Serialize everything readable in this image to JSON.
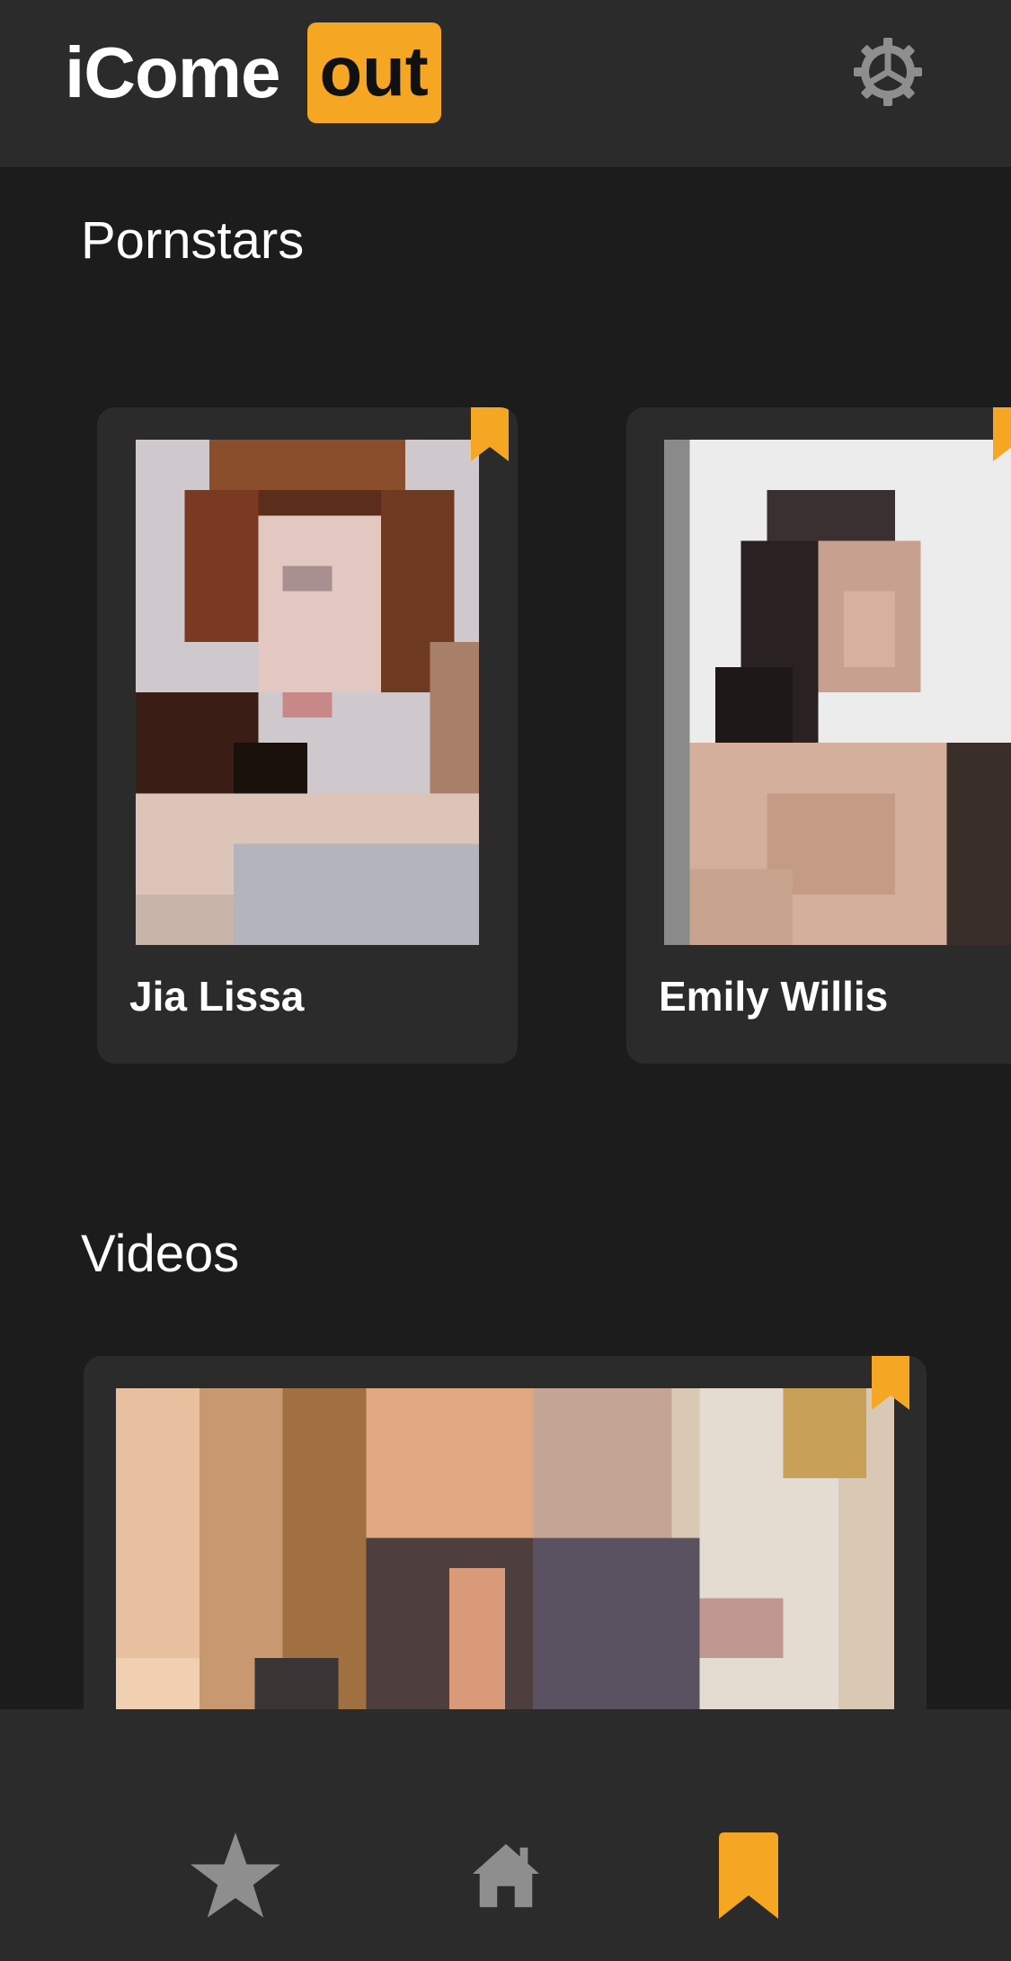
{
  "header": {
    "logo_text": "iCome",
    "logo_badge": "out",
    "settings_icon": "gear-icon"
  },
  "sections": {
    "pornstars_title": "Pornstars",
    "videos_title": "Videos"
  },
  "pornstars": [
    {
      "name": "Jia Lissa",
      "bookmarked": true
    },
    {
      "name": "Emily Willis",
      "bookmarked": true
    }
  ],
  "video": {
    "bookmarked": true
  },
  "bottom_nav": [
    {
      "icon": "star-icon",
      "active": false
    },
    {
      "icon": "home-icon",
      "active": false
    },
    {
      "icon": "bookmark-icon",
      "active": true
    }
  ],
  "colors": {
    "accent": "#f5a623",
    "header_bg": "#2b2b2b",
    "page_bg": "#1c1c1c",
    "card_bg": "#2b2b2b",
    "inactive_icon": "#8e8e8e"
  }
}
